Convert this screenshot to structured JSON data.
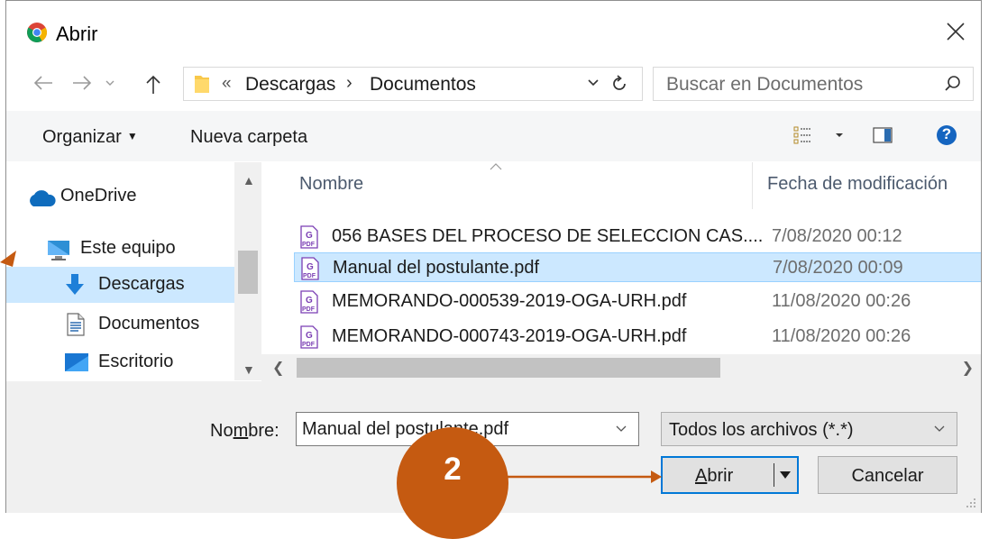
{
  "window": {
    "title": "Abrir",
    "app_icon": "chrome-icon"
  },
  "navigation": {
    "back_icon": "arrow-left-icon",
    "forward_icon": "arrow-right-icon",
    "recent_icon": "chevron-down-icon",
    "up_icon": "arrow-up-icon",
    "address_prefix": "«",
    "breadcrumbs": [
      "Descargas",
      "Documentos"
    ],
    "breadcrumb_separator": "›",
    "search_placeholder": "Buscar en Documentos"
  },
  "toolbar": {
    "organize_label": "Organizar",
    "new_folder_label": "Nueva carpeta",
    "help_label": "?"
  },
  "nav_pane": {
    "items": [
      {
        "label": "OneDrive",
        "icon": "cloud-icon"
      },
      {
        "label": "Este equipo",
        "icon": "computer-icon"
      },
      {
        "label": "Descargas",
        "icon": "download-icon",
        "selected": true
      },
      {
        "label": "Documentos",
        "icon": "document-icon"
      },
      {
        "label": "Escritorio",
        "icon": "desktop-icon"
      }
    ]
  },
  "file_list": {
    "columns": {
      "name": "Nombre",
      "date": "Fecha de modificación"
    },
    "files": [
      {
        "name": "056 BASES DEL PROCESO DE SELECCION CAS....",
        "date": "7/08/2020 00:12",
        "selected": false
      },
      {
        "name": "Manual del postulante.pdf",
        "date": "7/08/2020 00:09",
        "selected": true
      },
      {
        "name": "MEMORANDO-000539-2019-OGA-URH.pdf",
        "date": "11/08/2020 00:26",
        "selected": false
      },
      {
        "name": "MEMORANDO-000743-2019-OGA-URH.pdf",
        "date": "11/08/2020 00:26",
        "selected": false
      }
    ]
  },
  "footer": {
    "name_label_prefix": "No",
    "name_label_underlined": "m",
    "name_label_suffix": "bre:",
    "filename_value": "Manual del postulante.pdf",
    "filter_value": "Todos los archivos (*.*)",
    "open_underlined": "A",
    "open_rest": "brir",
    "cancel_label": "Cancelar"
  },
  "annotation": {
    "step_number": "2",
    "color": "#c55a11"
  },
  "colors": {
    "selection_bg": "#cce8ff",
    "accent_blue": "#0078d7",
    "header_text": "#4c5a6e"
  }
}
